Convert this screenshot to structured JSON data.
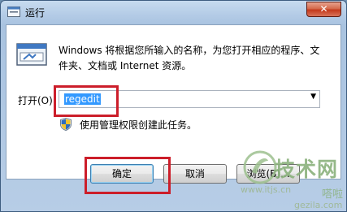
{
  "window": {
    "title": "运行",
    "close_glyph": "✕"
  },
  "dialog": {
    "description": "Windows 将根据您所输入的名称，为您打开相应的程序、文件夹、文档或 Internet 资源。",
    "open_label": "打开(O):",
    "open_value": "regedit",
    "admin_note": "使用管理权限创建此任务。"
  },
  "buttons": {
    "ok": "确定",
    "cancel": "取消",
    "browse": "浏览(B)..."
  },
  "icons": {
    "app": "run-icon",
    "program": "run-program-icon",
    "shield": "uac-shield-icon",
    "dropdown": "chevron-down-icon"
  },
  "annotations": {
    "highlight_color": "#cc1e2a"
  },
  "watermark": {
    "brand": "技术网",
    "url": "www.itjs.cn",
    "extra": "嗒啦",
    "site2": "gezila.com"
  }
}
